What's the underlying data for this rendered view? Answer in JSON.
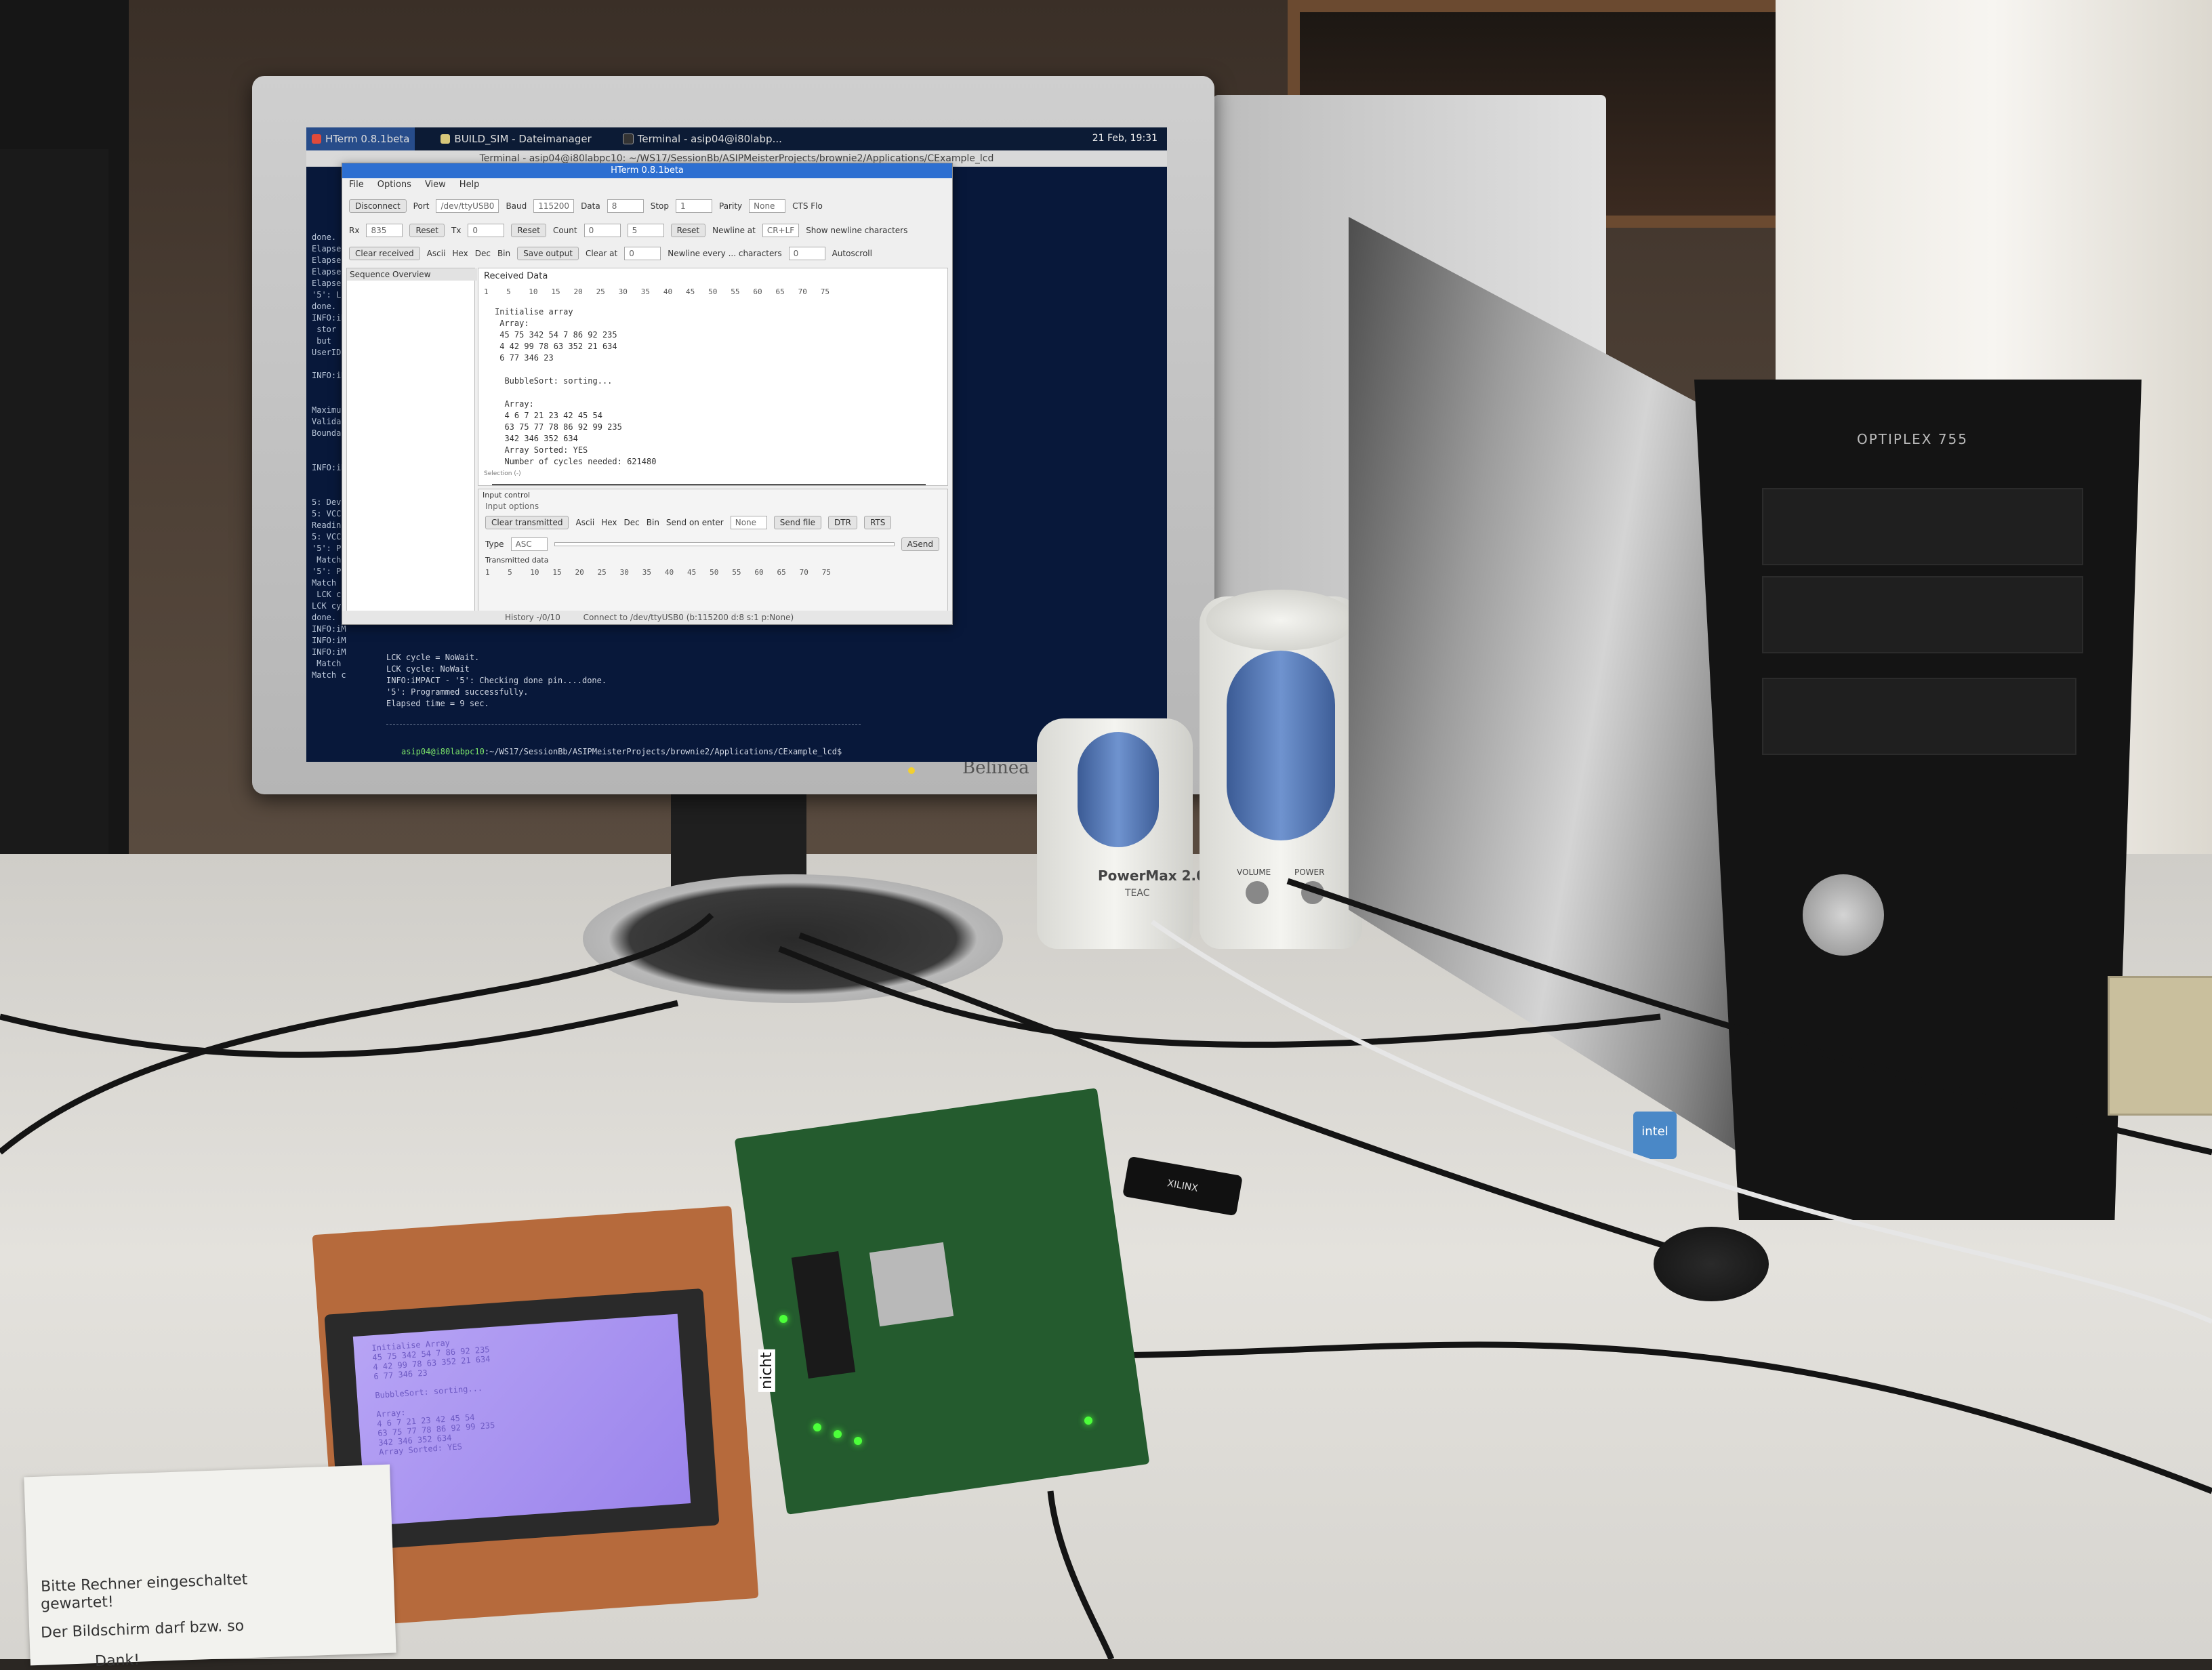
{
  "monitor": {
    "brand": "Belinea"
  },
  "taskbar": {
    "tasks": [
      {
        "label": "HTerm 0.8.1beta"
      },
      {
        "label": "BUILD_SIM - Dateimanager"
      },
      {
        "label": "Terminal - asip04@i80labp..."
      }
    ],
    "clock": "21 Feb, 19:31"
  },
  "terminal": {
    "title": "Terminal - asip04@i80labpc10: ~/WS17/SessionBb/ASIPMeisterProjects/brownie2/Applications/CExample_lcd",
    "side_lines": [
      "done.",
      "Elapsed",
      "Elapsed",
      "Elapsed",
      "Elapsed",
      "'5': L",
      "done.",
      "INFO:iM",
      " stor",
      " but",
      "UserID",
      "",
      "INFO:iM",
      "",
      "",
      "Maximum",
      "Validat",
      "Boundar",
      "",
      "",
      "INFO:iM",
      "",
      "",
      "5: Devi",
      "5: VCC",
      "Reading",
      "5: VCC",
      "'5': Pr",
      " Match",
      "'5': Pr",
      "Match c",
      " LCK cy",
      "LCK cyc",
      "done.",
      "INFO:iM",
      "INFO:iM",
      "INFO:iM",
      " Match",
      "Match c"
    ],
    "bottom_lines": [
      " LCK cycle = NoWait.",
      "LCK cycle: NoWait",
      "INFO:iMPACT - '5': Checking done pin....done.",
      "'5': Programmed successfully.",
      "Elapsed time =       9 sec."
    ],
    "prompt_host": "asip04@i80labpc10",
    "prompt_path": ":~/WS17/SessionBb/ASIPMeisterProjects/brownie2/Applications/CExample_lcd$"
  },
  "hterm": {
    "title": "HTerm 0.8.1beta",
    "menu": [
      "File",
      "Options",
      "View",
      "Help"
    ],
    "connect_button": "Disconnect",
    "port_label": "Port",
    "port_value": "/dev/ttyUSB0",
    "baud_label": "Baud",
    "baud_value": "115200",
    "data_label": "Data",
    "data_value": "8",
    "stop_label": "Stop",
    "stop_value": "1",
    "parity_label": "Parity",
    "parity_value": "None",
    "cts_label": "CTS Flo",
    "rx_label": "Rx",
    "rx_value": "835",
    "reset_label": "Reset",
    "tx_label": "Tx",
    "tx_value": "0",
    "count_label": "Count",
    "count_value": "0",
    "count_value2": "5",
    "newline_label": "Newline at",
    "newline_value": "CR+LF",
    "show_newline_label": "Show newline characters",
    "clear_received": "Clear received",
    "ascii_label": "Ascii",
    "hex_label": "Hex",
    "dec_label": "Dec",
    "bin_label": "Bin",
    "save_output": "Save output",
    "clear_at_label": "Clear at",
    "clear_at_value": "0",
    "newline_every_label": "Newline every ... characters",
    "newline_every_value": "0",
    "autoscroll_label": "Autoscroll",
    "sequence_overview": "Sequence Overview",
    "received_title": "Received Data",
    "ruler": "1    5    10   15   20   25   30   35   40   45   50   55   60   65   70   75",
    "received_lines": [
      "Initialise array",
      " Array:",
      " 45 75 342 54 7 86 92 235",
      " 4 42 99 78 63 352 21 634",
      " 6 77 346 23",
      "",
      "  BubbleSort: sorting...",
      "",
      "  Array:",
      "  4 6 7 21 23 42 45 54",
      "  63 75 77 78 86 92 99 235",
      "  342 346 352 634",
      "  Array Sorted: YES",
      "  Number of cycles needed: 621480"
    ],
    "selection_label": "Selection (-)",
    "input_control": "Input control",
    "input_options": "Input options",
    "clear_transmitted": "Clear transmitted",
    "send_on_enter_label": "Send on enter",
    "send_on_enter_value": "None",
    "send_file": "Send file",
    "dtr_label": "DTR",
    "rts_label": "RTS",
    "type_label": "Type",
    "type_value": "ASC",
    "asend_label": "ASend",
    "transmitted_title": "Transmitted data",
    "history_label": "History -/0/10",
    "connection_status": "Connect to /dev/ttyUSB0 (b:115200 d:8 s:1 p:None)"
  },
  "speaker": {
    "brand": "PowerMax 2.0",
    "sub": "TEAC",
    "volume_label": "VOLUME",
    "power_label": "POWER"
  },
  "pc": {
    "model": "OPTIPLEX 755"
  },
  "dongle": {
    "label": "XILINX"
  },
  "lcd_display": {
    "lines": [
      "  Initialise Array",
      "  45 75 342 54 7 86 92 235",
      "  4 42 99 78 63 352 21 634",
      "  6 77 346 23",
      "",
      "  BubbleSort: sorting...",
      "",
      "  Array:",
      "  4 6 7 21 23 42 45 54",
      "  63 75 77 78 86 92 99 235",
      "  342 346 352 634",
      "  Array Sorted: YES"
    ]
  },
  "board_label": "nicht",
  "note": {
    "line1": "Bitte Rechner eingeschaltet",
    "line2": "gewartet!",
    "line3": "Der Bildschirm darf bzw. so",
    "line4": "Dank!"
  },
  "colors": {
    "screen_bg": "#08183a",
    "hterm_title": "#2d6fd1",
    "lcd": "#9b84ec",
    "fpga_pcb": "#245b2e"
  }
}
